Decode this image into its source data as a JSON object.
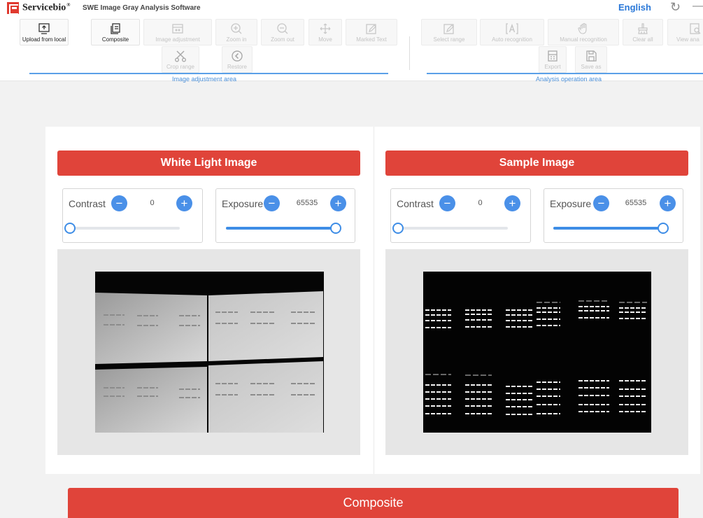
{
  "header": {
    "brand": "Servicebio",
    "brand_mark": "®",
    "app_title": "SWE Image Gray Analysis Software",
    "language": "English",
    "refresh_icon": "refresh-icon",
    "minimize_icon": "minimize-icon"
  },
  "toolbar": {
    "image_area": {
      "label": "Image adjustment area",
      "buttons": [
        {
          "label": "Upload from local",
          "icon": "upload-icon",
          "enabled": true
        },
        {
          "label": "Composite",
          "icon": "composite-icon",
          "enabled": true
        },
        {
          "label": "Image adjustment",
          "icon": "image-adjust-icon",
          "enabled": false
        },
        {
          "label": "Zoom in",
          "icon": "zoom-in-icon",
          "enabled": false
        },
        {
          "label": "Zoom out",
          "icon": "zoom-out-icon",
          "enabled": false
        },
        {
          "label": "Move",
          "icon": "move-icon",
          "enabled": false
        },
        {
          "label": "Marked Text",
          "icon": "marked-text-icon",
          "enabled": false
        },
        {
          "label": "Crop range",
          "icon": "scissors-icon",
          "enabled": false
        },
        {
          "label": "Restore",
          "icon": "restore-icon",
          "enabled": false
        }
      ]
    },
    "analysis_area": {
      "label": "Analysis operation area",
      "buttons": [
        {
          "label": "Select range",
          "icon": "select-range-icon",
          "enabled": false
        },
        {
          "label": "Auto recognition",
          "icon": "auto-recognition-icon",
          "enabled": false
        },
        {
          "label": "Manual recognition",
          "icon": "hand-icon",
          "enabled": false
        },
        {
          "label": "Clear all",
          "icon": "broom-icon",
          "enabled": false
        },
        {
          "label": "View ana",
          "icon": "view-analysis-icon",
          "enabled": false
        },
        {
          "label": "Export",
          "icon": "export-icon",
          "enabled": false
        },
        {
          "label": "Save as",
          "icon": "save-icon",
          "enabled": false
        }
      ]
    }
  },
  "white_light": {
    "title": "White Light Image",
    "contrast": {
      "label": "Contrast",
      "value": "0",
      "level": 0
    },
    "exposure": {
      "label": "Exposure",
      "value": "65535",
      "level": 1
    }
  },
  "sample": {
    "title": "Sample Image",
    "contrast": {
      "label": "Contrast",
      "value": "0",
      "level": 0
    },
    "exposure": {
      "label": "Exposure",
      "value": "65535",
      "level": 1
    }
  },
  "composite_button": "Composite",
  "colors": {
    "brand_red": "#e0443a",
    "accent_blue": "#3e8de6",
    "language_blue": "#2a78d8"
  }
}
